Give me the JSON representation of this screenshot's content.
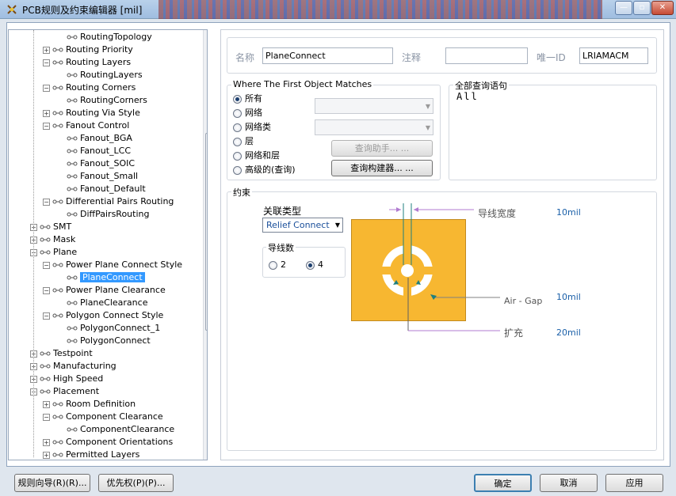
{
  "window": {
    "title": "PCB规则及约束编辑器 [mil]"
  },
  "tree": {
    "rows": [
      {
        "label": "RoutingTopology",
        "indent": 3
      },
      {
        "label": "Routing Priority",
        "indent": 2,
        "exp": "+"
      },
      {
        "label": "Routing Layers",
        "indent": 2,
        "exp": "-"
      },
      {
        "label": "RoutingLayers",
        "indent": 3
      },
      {
        "label": "Routing Corners",
        "indent": 2,
        "exp": "-"
      },
      {
        "label": "RoutingCorners",
        "indent": 3
      },
      {
        "label": "Routing Via Style",
        "indent": 2,
        "exp": "+"
      },
      {
        "label": "Fanout Control",
        "indent": 2,
        "exp": "-"
      },
      {
        "label": "Fanout_BGA",
        "indent": 3
      },
      {
        "label": "Fanout_LCC",
        "indent": 3
      },
      {
        "label": "Fanout_SOIC",
        "indent": 3
      },
      {
        "label": "Fanout_Small",
        "indent": 3
      },
      {
        "label": "Fanout_Default",
        "indent": 3
      },
      {
        "label": "Differential Pairs Routing",
        "indent": 2,
        "exp": "-"
      },
      {
        "label": "DiffPairsRouting",
        "indent": 3
      },
      {
        "label": "SMT",
        "indent": 1,
        "exp": "+"
      },
      {
        "label": "Mask",
        "indent": 1,
        "exp": "+"
      },
      {
        "label": "Plane",
        "indent": 1,
        "exp": "-"
      },
      {
        "label": "Power Plane Connect Style",
        "indent": 2,
        "exp": "-"
      },
      {
        "label": "PlaneConnect",
        "indent": 3,
        "selected": true
      },
      {
        "label": "Power Plane Clearance",
        "indent": 2,
        "exp": "-"
      },
      {
        "label": "PlaneClearance",
        "indent": 3
      },
      {
        "label": "Polygon Connect Style",
        "indent": 2,
        "exp": "-"
      },
      {
        "label": "PolygonConnect_1",
        "indent": 3
      },
      {
        "label": "PolygonConnect",
        "indent": 3
      },
      {
        "label": "Testpoint",
        "indent": 1,
        "exp": "+"
      },
      {
        "label": "Manufacturing",
        "indent": 1,
        "exp": "+"
      },
      {
        "label": "High Speed",
        "indent": 1,
        "exp": "+"
      },
      {
        "label": "Placement",
        "indent": 1,
        "exp": "-"
      },
      {
        "label": "Room Definition",
        "indent": 2,
        "exp": "+"
      },
      {
        "label": "Component Clearance",
        "indent": 2,
        "exp": "-"
      },
      {
        "label": "ComponentClearance",
        "indent": 3
      },
      {
        "label": "Component Orientations",
        "indent": 2,
        "exp": "+"
      },
      {
        "label": "Permitted Layers",
        "indent": 2,
        "exp": "+"
      }
    ]
  },
  "rule": {
    "name_label": "名称",
    "name_value": "PlaneConnect",
    "comment_label": "注释",
    "comment_value": "",
    "uid_label": "唯一ID",
    "uid_value": "LRIAMACM"
  },
  "match": {
    "title": "Where The First Object Matches",
    "options": [
      "所有",
      "网络",
      "网络类",
      "层",
      "网络和层",
      "高级的(查询)"
    ],
    "selected": 0,
    "query_helper": "查询助手... ...",
    "query_builder": "查询构建器... ..."
  },
  "query": {
    "title": "全部查询语句",
    "text": "All"
  },
  "constraints": {
    "title": "约束",
    "connect_type_label": "关联类型",
    "connect_type_value": "Relief Connect",
    "conductors_label": "导线数",
    "conductor_options": [
      "2",
      "4"
    ],
    "conductor_selected": 1,
    "width_label": "导线宽度",
    "width_value": "10mil",
    "airgap_label": "Air - Gap",
    "airgap_value": "10mil",
    "expansion_label": "扩充",
    "expansion_value": "20mil"
  },
  "buttons": {
    "rule_wizard": "规则向导(R)(R)...",
    "priority": "优先权(P)(P)...",
    "ok": "确定",
    "cancel": "取消",
    "apply": "应用"
  },
  "colors": {
    "pad": "#f7b731",
    "selection": "#3399ff",
    "accent_text": "#1a5fa8"
  }
}
